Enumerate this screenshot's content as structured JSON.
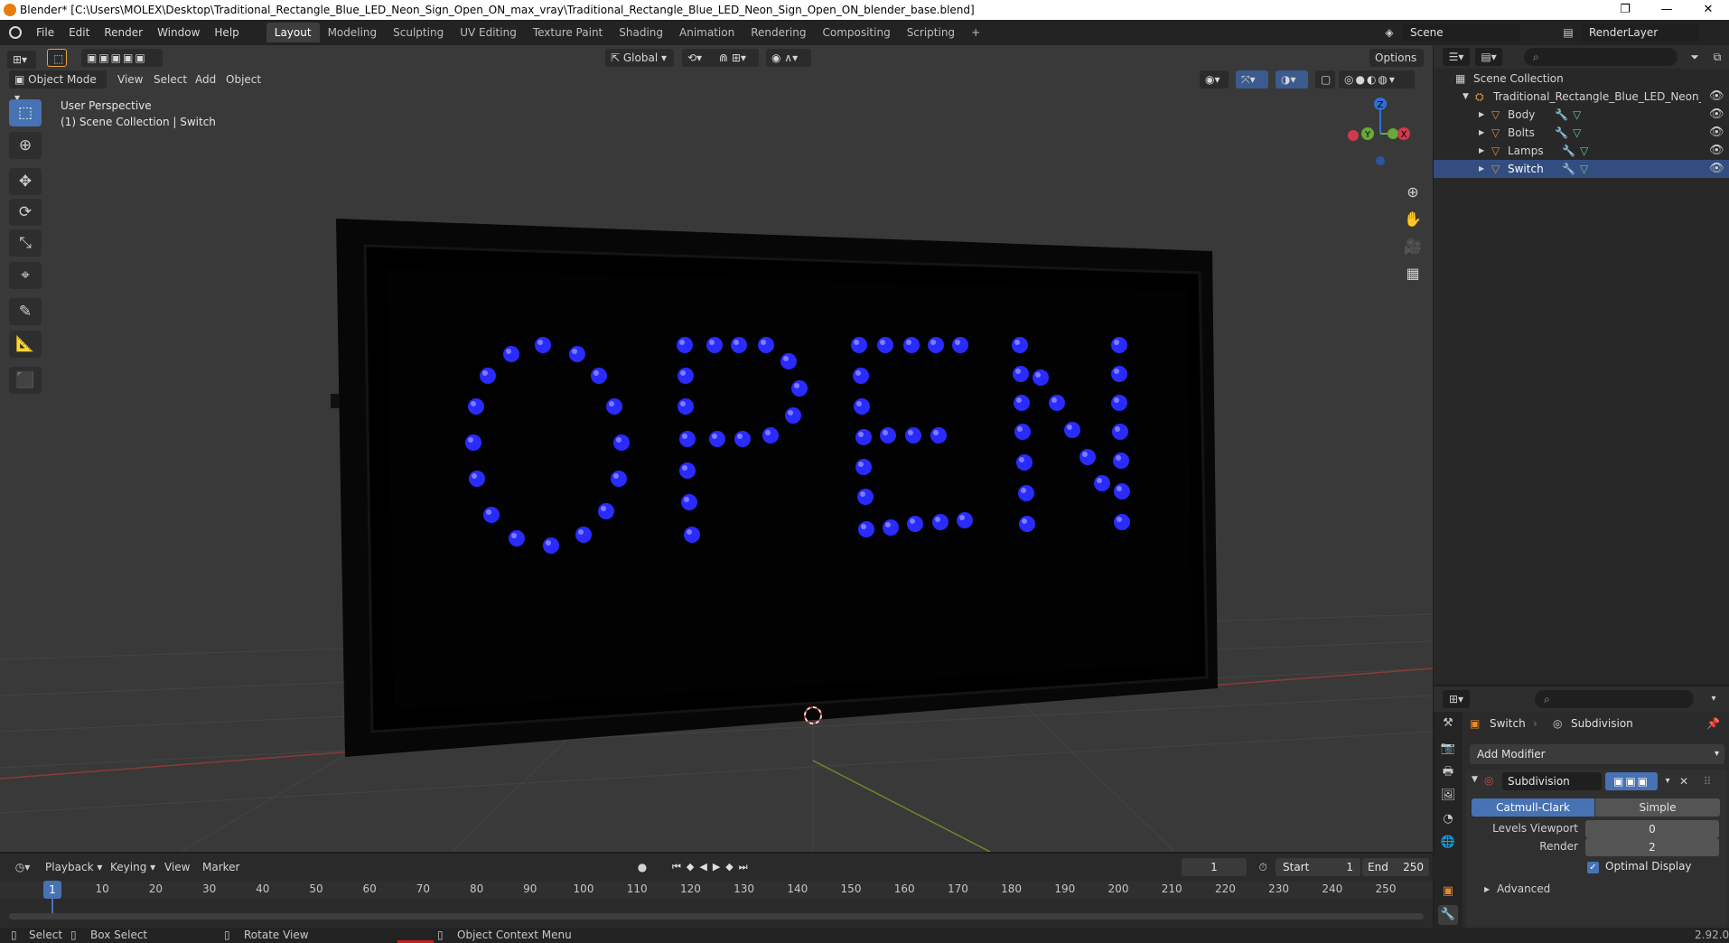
{
  "window": {
    "title": "Blender* [C:\\Users\\MOLEX\\Desktop\\Traditional_Rectangle_Blue_LED_Neon_Sign_Open_ON_max_vray\\Traditional_Rectangle_Blue_LED_Neon_Sign_Open_ON_blender_base.blend]",
    "minimize": "—",
    "maximize": "❐",
    "close": "✕"
  },
  "menu": [
    "File",
    "Edit",
    "Render",
    "Window",
    "Help"
  ],
  "workspaces": [
    "Layout",
    "Modeling",
    "Sculpting",
    "UV Editing",
    "Texture Paint",
    "Shading",
    "Animation",
    "Rendering",
    "Compositing",
    "Scripting"
  ],
  "workspace_add": "+",
  "scene": {
    "label": "Scene",
    "render_layer": "RenderLayer"
  },
  "viewport": {
    "mode": "Object Mode",
    "menus": [
      "View",
      "Select",
      "Add",
      "Object"
    ],
    "transform_orientation": "Global",
    "options": "Options",
    "overlay_title": "User Perspective",
    "overlay_subtitle": "(1) Scene Collection | Switch",
    "sign_letters": "OPEN",
    "led_color": "#2a2bff",
    "gizmo": {
      "z": "Z",
      "y": "Y",
      "x": "X"
    }
  },
  "outliner": {
    "root": "Scene Collection",
    "collection": "Traditional_Rectangle_Blue_LED_Neon_Sign_",
    "objects": [
      "Body",
      "Bolts",
      "Lamps",
      "Switch"
    ]
  },
  "properties": {
    "object_name": "Switch",
    "modifier_name": "Subdivision",
    "add_modifier": "Add Modifier",
    "modifier_panel_name": "Subdivision",
    "mode_catmull": "Catmull-Clark",
    "mode_simple": "Simple",
    "levels_viewport_label": "Levels Viewport",
    "levels_viewport_value": "0",
    "render_label": "Render",
    "render_value": "2",
    "optimal_display": "Optimal Display",
    "advanced": "Advanced",
    "version": "2.92.0"
  },
  "timeline": {
    "menus": [
      "Playback",
      "Keying",
      "View",
      "Marker"
    ],
    "current_frame": "1",
    "start_label": "Start",
    "start_value": "1",
    "end_label": "End",
    "end_value": "250",
    "ticks": [
      "1",
      "10",
      "20",
      "30",
      "40",
      "50",
      "60",
      "70",
      "80",
      "90",
      "100",
      "110",
      "120",
      "130",
      "140",
      "150",
      "160",
      "170",
      "180",
      "190",
      "200",
      "210",
      "220",
      "230",
      "240",
      "250"
    ]
  },
  "status": {
    "select": "Select",
    "box_select": "Box Select",
    "rotate_view": "Rotate View",
    "context_menu": "Object Context Menu"
  }
}
